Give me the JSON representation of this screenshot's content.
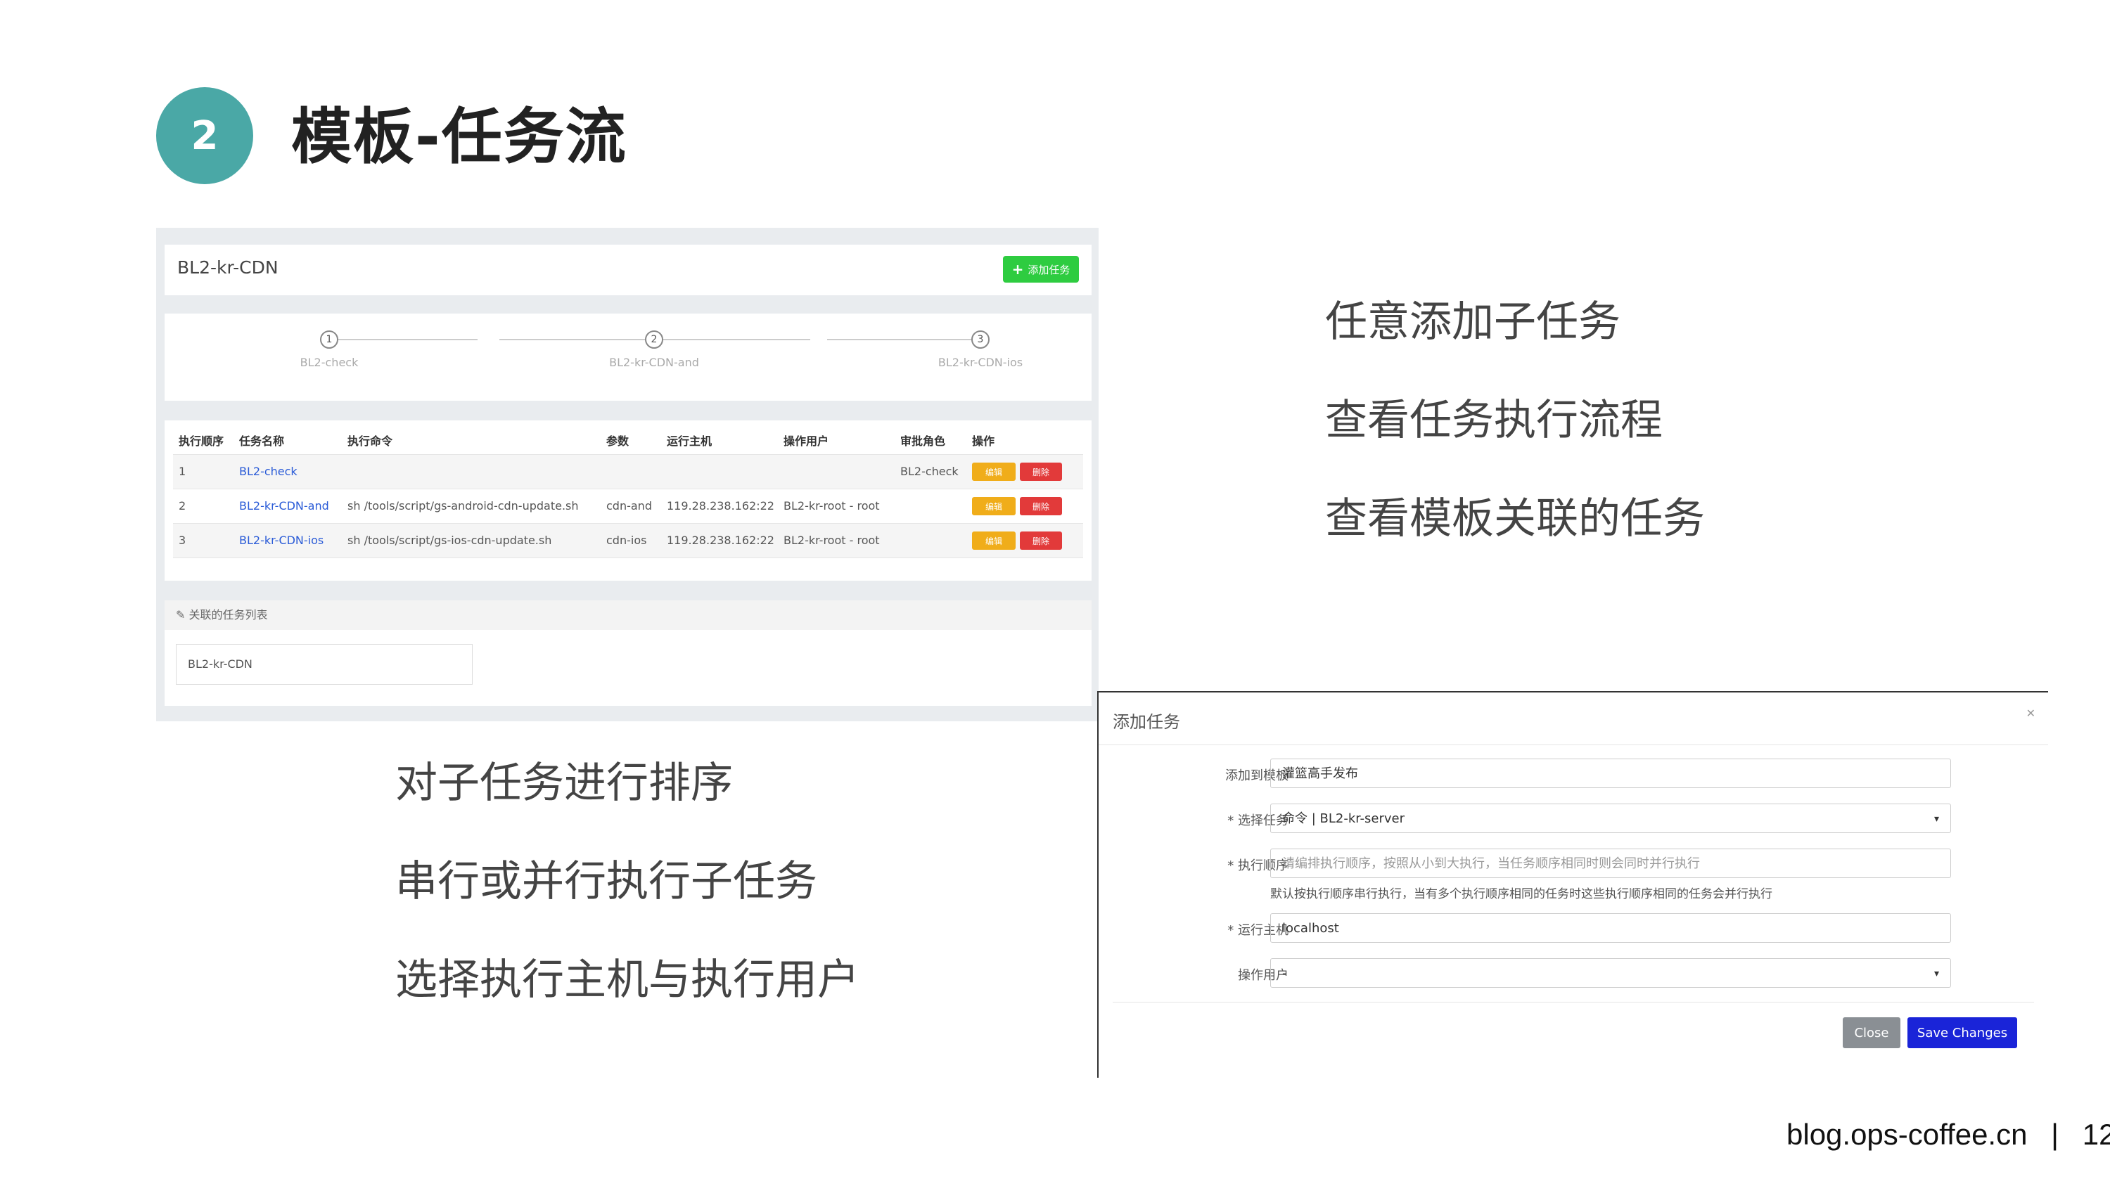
{
  "slide": {
    "number": "2",
    "title": "模板-任务流",
    "footer_site": "blog.ops-coffee.cn",
    "footer_sep": "|",
    "page_number": "12",
    "accent_color": "#4aa8a6"
  },
  "features_right": [
    "任意添加子任务",
    "查看任务执行流程",
    "查看模板关联的任务"
  ],
  "features_left": [
    "对子任务进行排序",
    "串行或并行执行子任务",
    "选择执行主机与执行用户"
  ],
  "template_page": {
    "header_title": "BL2-kr-CDN",
    "add_button_icon": "plus-icon",
    "add_button": "添加任务",
    "steps": [
      {
        "num": "1",
        "label": "BL2-check"
      },
      {
        "num": "2",
        "label": "BL2-kr-CDN-and"
      },
      {
        "num": "3",
        "label": "BL2-kr-CDN-ios"
      }
    ],
    "table": {
      "columns": [
        "执行顺序",
        "任务名称",
        "执行命令",
        "参数",
        "运行主机",
        "操作用户",
        "审批角色",
        "操作"
      ],
      "rows": [
        {
          "order": "1",
          "name": "BL2-check",
          "cmd": "",
          "param": "",
          "host": "",
          "user": "",
          "role": "BL2-check"
        },
        {
          "order": "2",
          "name": "BL2-kr-CDN-and",
          "cmd": "sh /tools/script/gs-android-cdn-update.sh",
          "param": "cdn-and",
          "host": "119.28.238.162:22",
          "user": "BL2-kr-root - root",
          "role": ""
        },
        {
          "order": "3",
          "name": "BL2-kr-CDN-ios",
          "cmd": "sh /tools/script/gs-ios-cdn-update.sh",
          "param": "cdn-ios",
          "host": "119.28.238.162:22",
          "user": "BL2-kr-root - root",
          "role": ""
        }
      ],
      "edit_label": "编辑",
      "delete_label": "删除",
      "edit_color": "#f0ad1a",
      "delete_color": "#e23a3a"
    },
    "related_title": "关联的任务列表",
    "related_icon": "link-icon",
    "related_item": "BL2-kr-CDN"
  },
  "modal": {
    "title": "添加任务",
    "close_icon": "close-icon",
    "fields": [
      {
        "label": "添加到模板",
        "value": "灌篮高手发布"
      },
      {
        "label": "* 选择任务",
        "value": "命令 | BL2-kr-server"
      },
      {
        "label": "* 执行顺序",
        "placeholder": "请编排执行顺序，按照从小到大执行，当任务顺序相同时则会同时并行执行",
        "help": "默认按执行顺序串行执行，当有多个执行顺序相同的任务时这些执行顺序相同的任务会并行执行"
      },
      {
        "label": "* 运行主机",
        "value": "localhost"
      },
      {
        "label": "操作用户",
        "value": "-"
      }
    ],
    "close_button": "Close",
    "save_button": "Save Changes",
    "save_color": "#1a24d8"
  }
}
